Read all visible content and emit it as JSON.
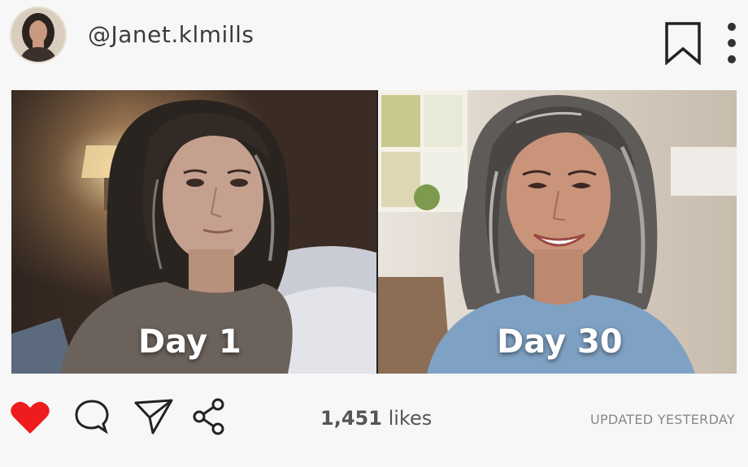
{
  "profile": {
    "username": "@Janet.klmills",
    "avatar_icon": "avatar-portrait-woman"
  },
  "header": {
    "bookmark_icon": "bookmark-icon",
    "more_icon": "more-vertical-icon"
  },
  "photo": {
    "left_caption": "Day 1",
    "right_caption": "Day 30"
  },
  "actions": {
    "like_icon": "heart-icon",
    "like_color": "#ee1c1c",
    "comment_icon": "comment-icon",
    "send_icon": "send-icon",
    "share_icon": "share-icon"
  },
  "stats": {
    "likes_count": "1,451",
    "likes_label": "likes",
    "updated": "UPDATED YESTERDAY"
  }
}
